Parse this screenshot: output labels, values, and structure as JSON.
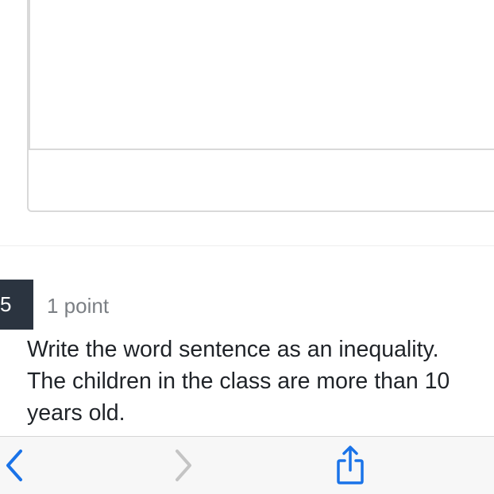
{
  "question": {
    "number": "5",
    "points": "1 point",
    "text_lines": [
      "Write the word sentence as an inequality.",
      "The children in the class are more than 10",
      "years old."
    ]
  },
  "toolbar": {
    "back_icon": "chevron-left-icon",
    "forward_icon": "chevron-right-icon",
    "share_icon": "share-icon"
  },
  "colors": {
    "accent": "#1a73e8",
    "disabled": "#c4c4c4",
    "question_tab": "#2b3440"
  }
}
